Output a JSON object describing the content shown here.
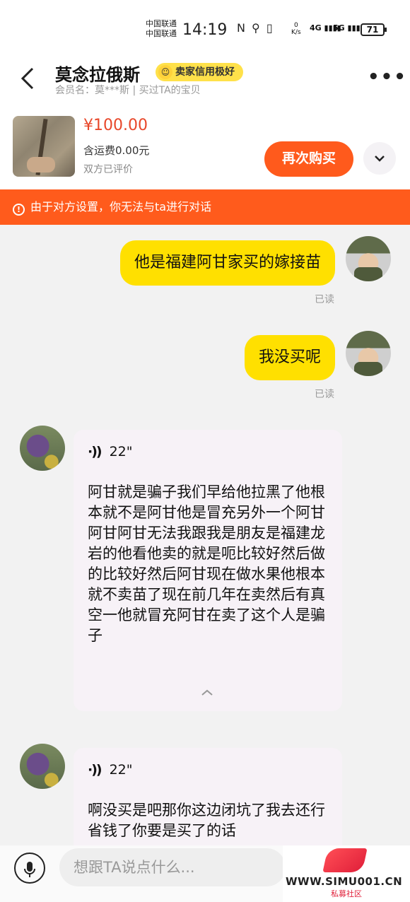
{
  "status_bar": {
    "carrier1": "中国联通",
    "carrier2": "中国联通",
    "time": "14:19",
    "icons": "N ⚲ ▯",
    "speed_value": "0",
    "speed_unit": "K/s",
    "network1": "4G",
    "network2": "5G",
    "battery": "71"
  },
  "header": {
    "shop_name": "莫念拉俄斯",
    "badge": "卖家信用极好",
    "member_info": "会员名：莫***斯 | 买过TA的宝贝"
  },
  "product": {
    "price": "¥100.00",
    "shipping": "含运费0.00元",
    "review_status": "双方已评价",
    "buy_again": "再次购买"
  },
  "notice": {
    "text": "由于对方设置，你无法与ta进行对话"
  },
  "messages": {
    "m1": {
      "text": "他是福建阿甘家买的嫁接苗",
      "status": "已读"
    },
    "m2": {
      "text": "我没买呢",
      "status": "已读"
    },
    "v1": {
      "duration": "22\"",
      "transcript": "阿甘就是骗子我们早给他拉黑了他根本就不是阿甘他是冒充另外一个阿甘阿甘阿甘无法我跟我是朋友是福建龙岩的他看他卖的就是呃比较好然后做的比较好然后阿甘现在做水果他根本就不卖苗了现在前几年在卖然后有真空一他就冒充阿甘在卖了这个人是骗子"
    },
    "v2": {
      "duration": "22\"",
      "transcript": "啊没买是吧那你这边闭坑了我去还行省钱了你要是买了的话"
    }
  },
  "input": {
    "placeholder": "想跟TA说点什么..."
  },
  "watermark": {
    "site": "WWW.SIMU001.CN",
    "name": "私募社区"
  },
  "icons": {
    "back": "back-arrow-icon",
    "more": "more-dots-icon",
    "expand": "chevron-down-icon",
    "notice": "info-icon",
    "voice": "voice-wave-icon",
    "collapse": "chevron-up-icon",
    "mic": "microphone-icon"
  },
  "colors": {
    "accent": "#ff5b1c",
    "price": "#e8472a",
    "bubble": "#ffe000",
    "badge": "#ffe14a"
  }
}
